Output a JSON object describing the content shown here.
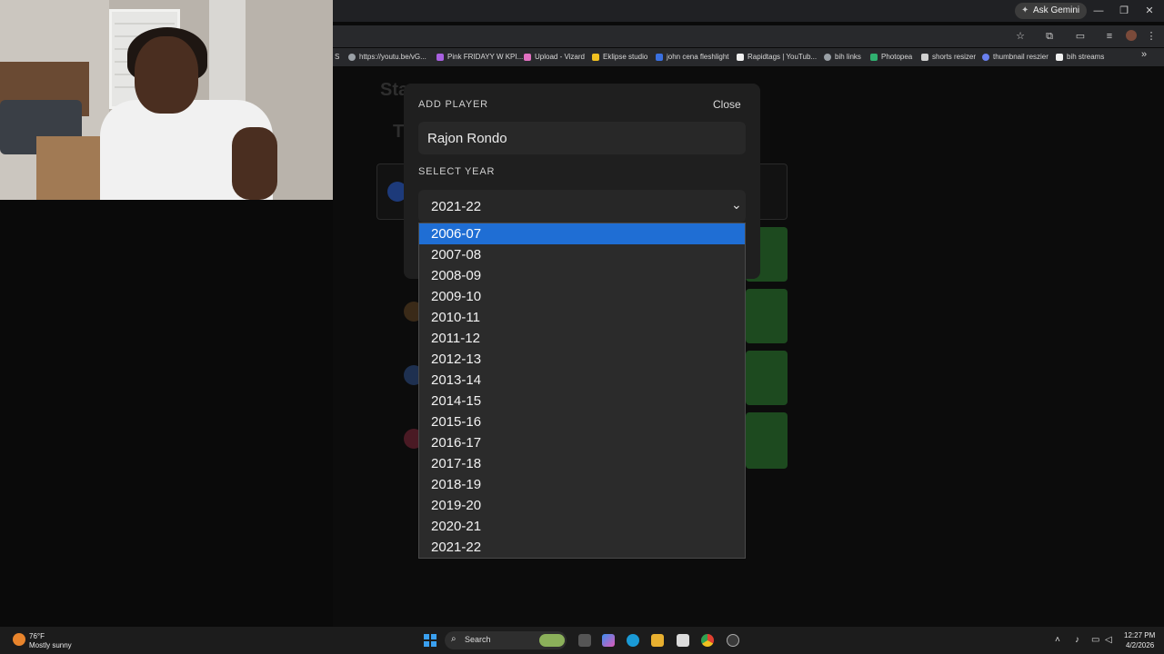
{
  "browser": {
    "ask_gemini": "Ask Gemini",
    "bookmarks": [
      {
        "label": "S",
        "color": "#888888"
      },
      {
        "label": "https://youtu.be/vG...",
        "color": "#9aa0a6"
      },
      {
        "label": "Pink FRIDAYY W KPI...",
        "color": "#a860e0"
      },
      {
        "label": "Upload - Vizard",
        "color": "#e070c0"
      },
      {
        "label": "Eklipse studio",
        "color": "#f0c020"
      },
      {
        "label": "john cena fleshlight",
        "color": "#3a70e0"
      },
      {
        "label": "Rapidtags | YouTub...",
        "color": "#f0f0f0"
      },
      {
        "label": "bih links",
        "color": "#9aa0a6"
      },
      {
        "label": "Photopea",
        "color": "#30b070"
      },
      {
        "label": "shorts resizer",
        "color": "#d0d0d0"
      },
      {
        "label": "thumbnail reszier",
        "color": "#6a80f0"
      },
      {
        "label": "bih streams",
        "color": "#f0f0f0"
      }
    ]
  },
  "background": {
    "header_fragment": "Sta",
    "title_fragment": "T"
  },
  "modal": {
    "title": "ADD PLAYER",
    "close_label": "Close",
    "player_name": "Rajon Rondo",
    "year_label": "SELECT YEAR",
    "selected_year": "2021-22"
  },
  "dropdown": {
    "highlighted": "2006-07",
    "options": [
      "2006-07",
      "2007-08",
      "2008-09",
      "2009-10",
      "2010-11",
      "2011-12",
      "2012-13",
      "2013-14",
      "2014-15",
      "2015-16",
      "2016-17",
      "2017-18",
      "2018-19",
      "2019-20",
      "2020-21",
      "2021-22"
    ]
  },
  "taskbar": {
    "weather_temp": "76°F",
    "weather_desc": "Mostly sunny",
    "search_label": "Search",
    "time": "12:27 PM",
    "date": "4/2/2026"
  },
  "colors": {
    "accent_selected": "#1f6ed4",
    "modal_bg": "#1f1f1f",
    "dropdown_bg": "#2b2b2b"
  }
}
